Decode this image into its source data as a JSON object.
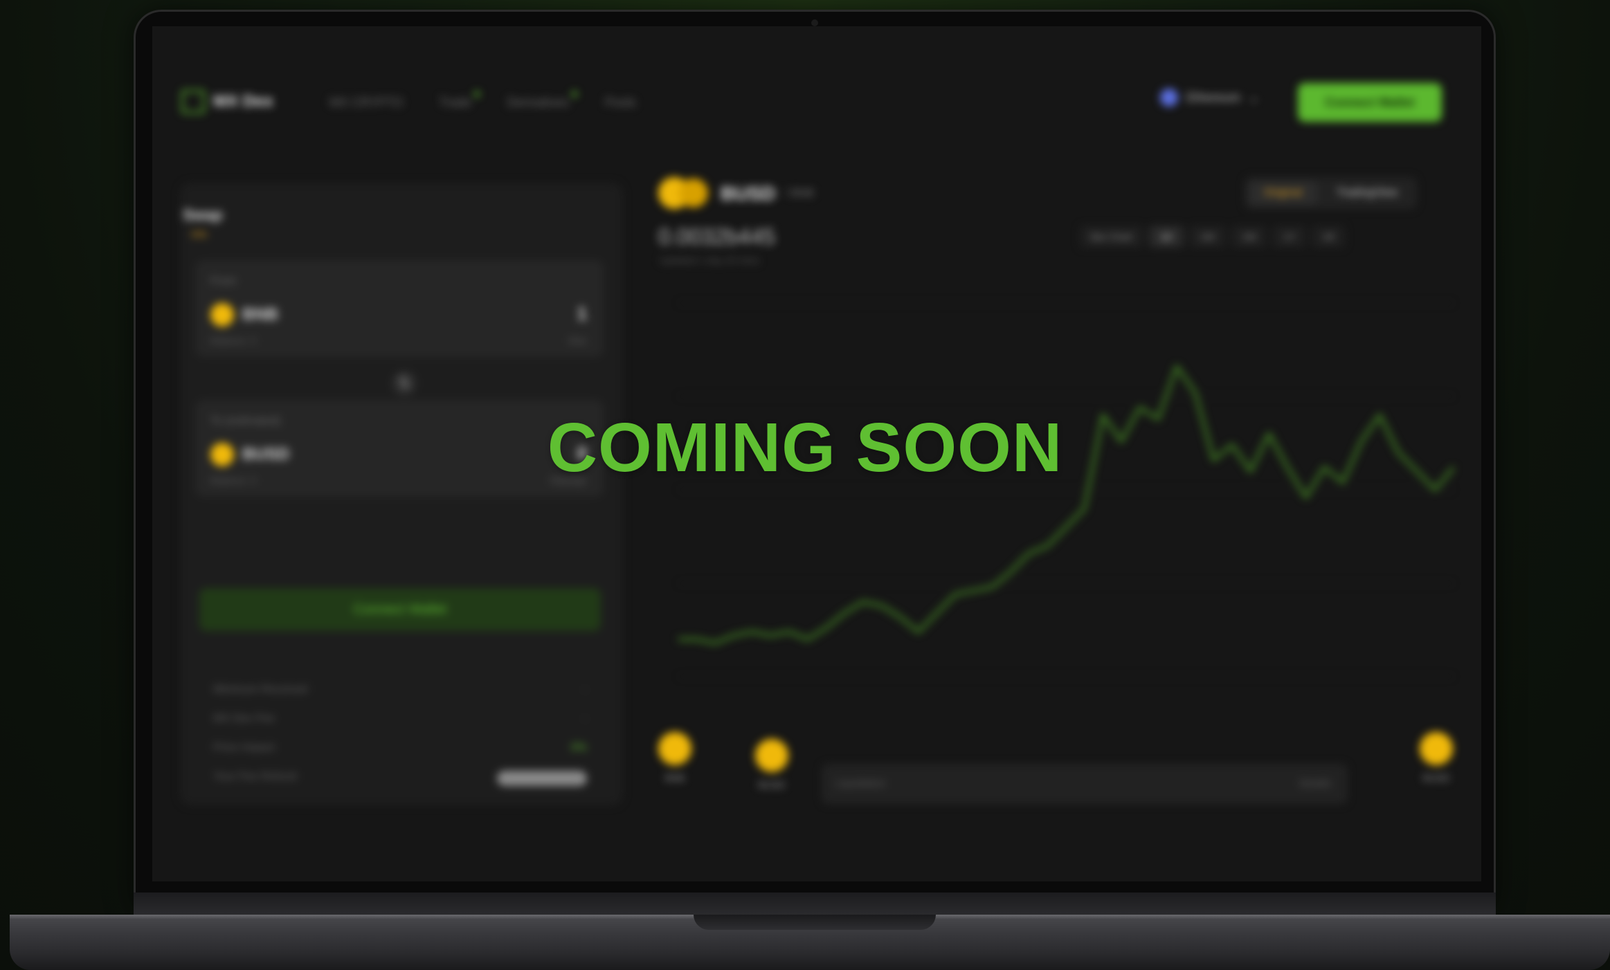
{
  "overlay": {
    "text": "COMING SOON"
  },
  "app": {
    "logo_text": "MX Dex",
    "nav": [
      "MX CRYPTO",
      "Trade",
      "Derivatives",
      "Pools"
    ],
    "network": "Ethereum",
    "connect_button": "Connect Wallet"
  },
  "swap": {
    "title": "Swap",
    "subtitle": "Info",
    "from": {
      "label": "From",
      "token": "BNB",
      "amount": "1",
      "balance": "Balance: 0",
      "right": "Max"
    },
    "to": {
      "label": "To (estimated)",
      "token": "BUSD",
      "amount": "0",
      "balance": "Balance: 0",
      "right": "Slippage"
    },
    "connect_wallet": "Connect Wallet",
    "info": [
      {
        "label": "Minimum Received",
        "value": "-"
      },
      {
        "label": "MX Dex Fee",
        "value": "-"
      },
      {
        "label": "Price Impact",
        "value": "0%"
      },
      {
        "label": "Your Fee Refund",
        "value": ""
      }
    ]
  },
  "chart": {
    "pair": "BUSD",
    "pair_sub": "/ BNB",
    "price": "0.0032b445",
    "price_sub": "Updated 1 day 20 mins",
    "tabs": [
      "Original",
      "TradingView"
    ],
    "range_label": "Bar Chart",
    "ranges": [
      "1D",
      "1W",
      "1M",
      "1Y",
      "All"
    ],
    "route": {
      "from": "BNB",
      "via": "BUSD",
      "to": "BUSD",
      "label": "Liquidation",
      "right": "Details"
    },
    "accent": "#5cb82f"
  },
  "chart_data": {
    "type": "line",
    "series": [
      {
        "values": [
          10,
          10,
          9,
          11,
          12,
          11,
          12,
          10,
          13,
          17,
          20,
          19,
          16,
          12,
          17,
          22,
          23,
          24,
          28,
          33,
          35,
          40,
          45,
          70,
          63,
          72,
          69,
          83,
          76,
          58,
          62,
          55,
          65,
          56,
          48,
          56,
          52,
          63,
          70,
          60,
          55,
          50,
          56
        ]
      }
    ]
  }
}
